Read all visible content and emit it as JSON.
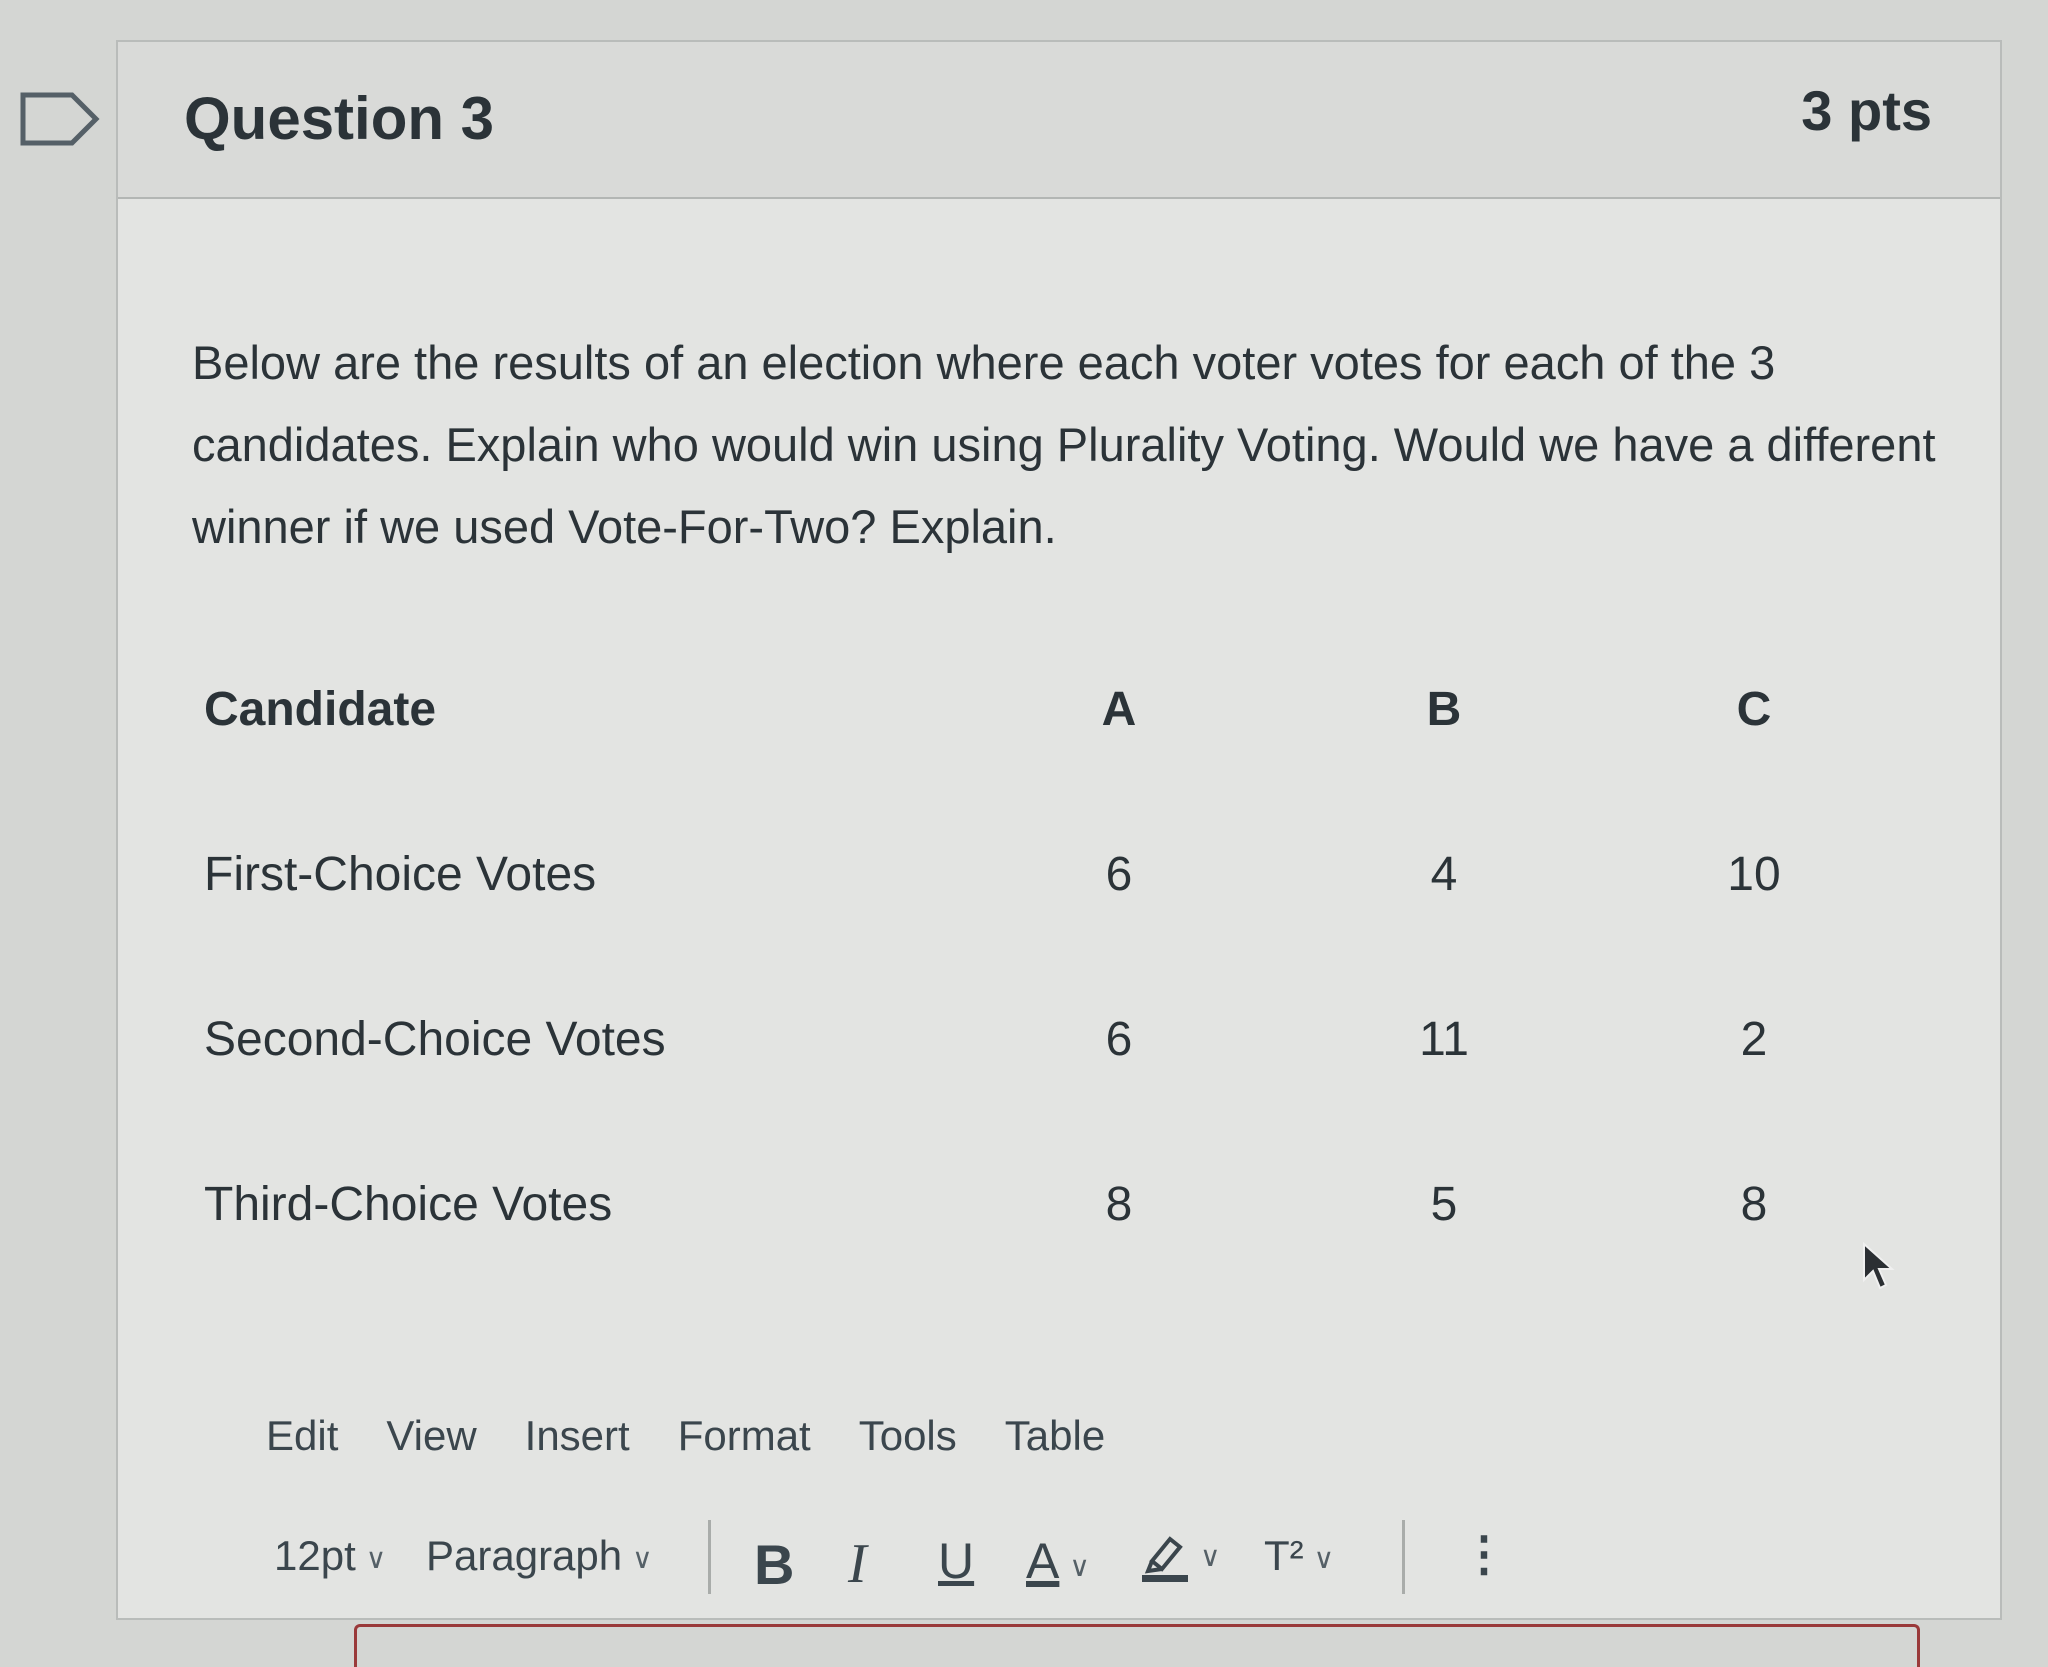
{
  "question": {
    "title": "Question 3",
    "points": "3 pts",
    "text": "Below are the results of an election where each voter votes for each of the 3 candidates. Explain who would win using Plurality Voting. Would we have a different winner if we used Vote-For-Two? Explain."
  },
  "table": {
    "header": {
      "label": "Candidate",
      "a": "A",
      "b": "B",
      "c": "C"
    },
    "rows": [
      {
        "label": "First-Choice Votes",
        "a": "6",
        "b": "4",
        "c": "10"
      },
      {
        "label": "Second-Choice Votes",
        "a": "6",
        "b": "11",
        "c": "2"
      },
      {
        "label": "Third-Choice Votes",
        "a": "8",
        "b": "5",
        "c": "8"
      }
    ]
  },
  "editor": {
    "menu": [
      "Edit",
      "View",
      "Insert",
      "Format",
      "Tools",
      "Table"
    ],
    "font_size": "12pt",
    "block_format": "Paragraph",
    "bold": "B",
    "italic": "I",
    "underline": "U",
    "font_color": "A",
    "superscript": "T²",
    "more": "⋮"
  }
}
